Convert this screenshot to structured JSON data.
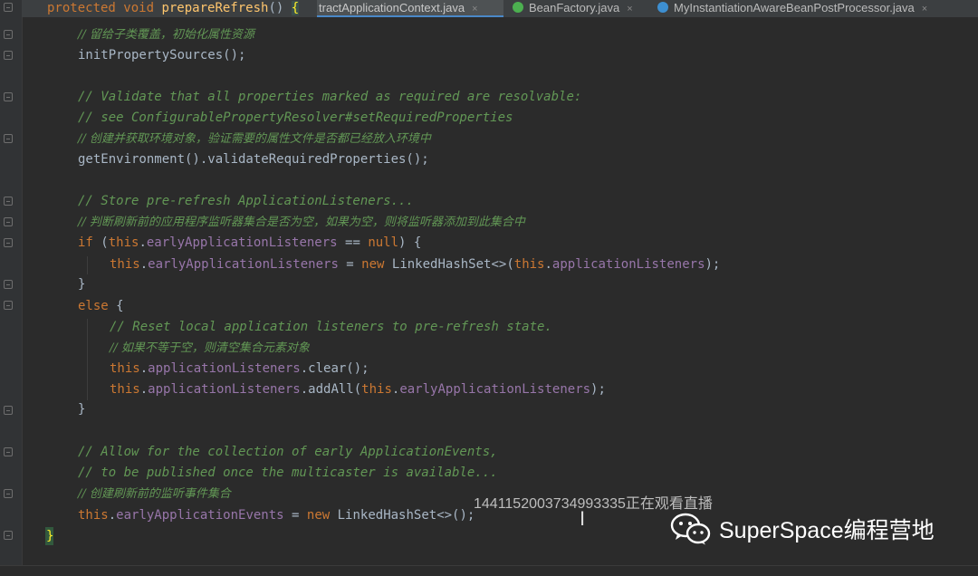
{
  "editor": {
    "signature": {
      "kw1": "protected",
      "kw2": "void",
      "method": "prepareRefresh",
      "parens": "()",
      "brace": "{"
    },
    "tabs": [
      {
        "label": "tractApplicationContext.java",
        "close": "×"
      },
      {
        "label": "BeanFactory.java",
        "close": "×"
      },
      {
        "label": "MyInstantiationAwareBeanPostProcessor.java",
        "close": "×"
      }
    ],
    "code": {
      "l1": "// 留给子类覆盖，初始化属性资源",
      "l2": "initPropertySources();",
      "l3": "// Validate that all properties marked as required are resolvable:",
      "l4": "// see ConfigurablePropertyResolver#setRequiredProperties",
      "l5": "// 创建并获取环境对象，验证需要的属性文件是否都已经放入环境中",
      "l6": "getEnvironment().validateRequiredProperties();",
      "l7": "// Store pre-refresh ApplicationListeners...",
      "l8": "// 判断刷新前的应用程序监听器集合是否为空，如果为空，则将监听器添加到此集合中",
      "if_kw": "if",
      "this": "this",
      "earlyListeners": "earlyApplicationListeners",
      "eqnull": " == ",
      "null_kw": "null",
      "openb": ") {",
      "assign": " = ",
      "new_kw": "new",
      "linked": " LinkedHashSet<>(",
      "appListeners": "applicationListeners",
      "closeParen": ");",
      "rbrace": "}",
      "else_kw": "else",
      "obrace": " {",
      "l13": "// Reset local application listeners to pre-refresh state.",
      "l14": "// 如果不等于空，则清空集合元素对象",
      "clear": ".clear();",
      "addAll": ".addAll(",
      "l18": "// Allow for the collection of early ApplicationEvents,",
      "l19": "// to be published once the multicaster is available...",
      "l20": "// 创建刷新前的监听事件集合",
      "earlyEvents": "earlyApplicationEvents",
      "linked2": " LinkedHashSet<>();",
      "dot": ".",
      "paren_open": " (",
      "closing": "}"
    }
  },
  "overlay": {
    "viewers": "1441152003734993335正在观看直播",
    "watermark": "SuperSpace编程营地"
  },
  "colors": {
    "background": "#2b2b2b",
    "keyword": "#cc7832",
    "comment": "#629755",
    "field": "#9876aa",
    "method": "#ffc66d",
    "text": "#a9b7c6"
  }
}
